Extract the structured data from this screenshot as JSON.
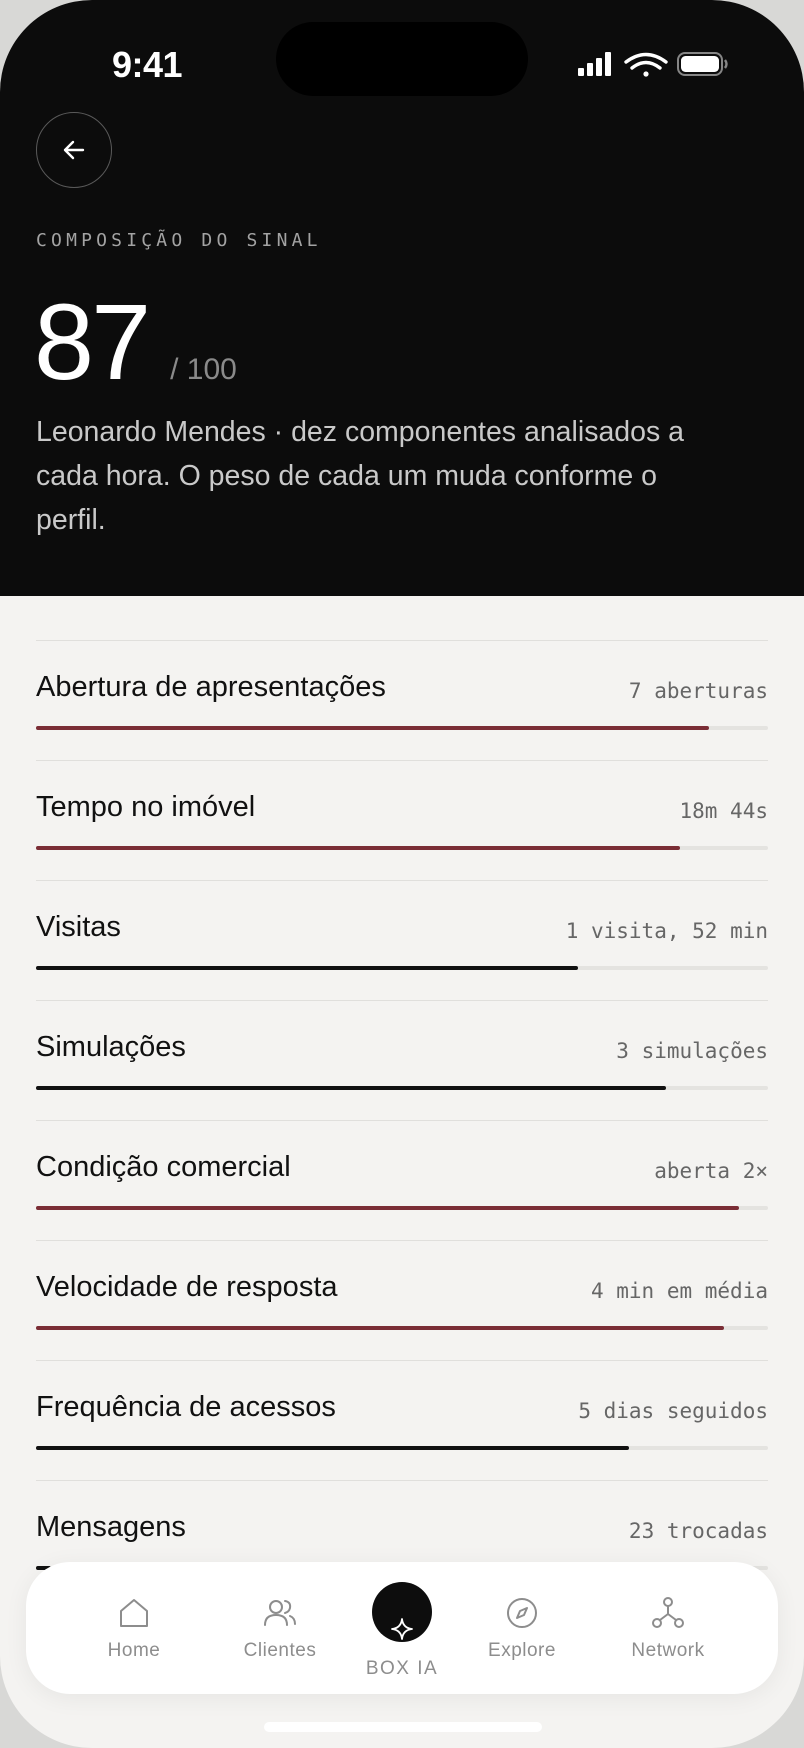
{
  "status_bar": {
    "time": "9:41"
  },
  "header": {
    "eyebrow": "COMPOSIÇÃO DO SINAL",
    "score": "87",
    "score_max": "/ 100",
    "description": "Leonardo Mendes · dez componentes analisados a cada hora. O peso de cada um muda conforme o perfil."
  },
  "colors": {
    "accent": "#7a2d35",
    "dark": "#111111",
    "track": "#e4e3e0"
  },
  "metrics": [
    {
      "label": "Abertura de apresentações",
      "value": "7 aberturas",
      "level": 0.92,
      "color": "#7a2d35"
    },
    {
      "label": "Tempo no imóvel",
      "value": "18m 44s",
      "level": 0.88,
      "color": "#7a2d35"
    },
    {
      "label": "Visitas",
      "value": "1 visita, 52 min",
      "level": 0.74,
      "color": "#111111"
    },
    {
      "label": "Simulações",
      "value": "3 simulações",
      "level": 0.86,
      "color": "#111111"
    },
    {
      "label": "Condição comercial",
      "value": "aberta 2×",
      "level": 0.96,
      "color": "#7a2d35"
    },
    {
      "label": "Velocidade de resposta",
      "value": "4 min em média",
      "level": 0.94,
      "color": "#7a2d35"
    },
    {
      "label": "Frequência de acessos",
      "value": "5 dias seguidos",
      "level": 0.81,
      "color": "#111111"
    },
    {
      "label": "Mensagens",
      "value": "23 trocadas",
      "level": 0.02,
      "color": "#111111"
    }
  ],
  "tabbar": {
    "home": {
      "label": "Home",
      "icon": "home-icon"
    },
    "clientes": {
      "label": "Clientes",
      "icon": "users-icon"
    },
    "box_ia": {
      "label": "BOX IA",
      "icon": "sparkle-icon"
    },
    "explore": {
      "label": "Explore",
      "icon": "compass-icon"
    },
    "network": {
      "label": "Network",
      "icon": "network-icon"
    }
  }
}
